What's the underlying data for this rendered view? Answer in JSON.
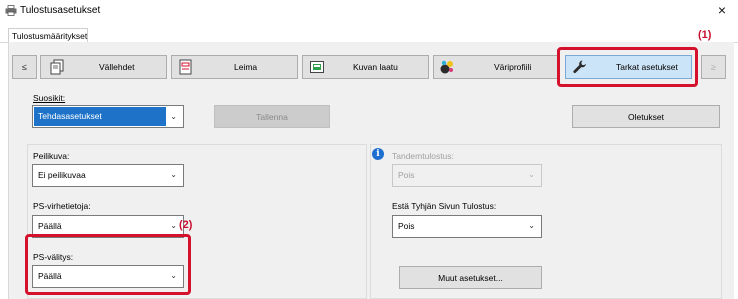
{
  "window": {
    "title": "Tulostusasetukset",
    "close_glyph": "×"
  },
  "tabs": [
    {
      "label": "Tulostusmääritykset"
    }
  ],
  "toolbar": {
    "prev_glyph": "≤",
    "next_glyph": "≥",
    "buttons": [
      {
        "label": "Vällehdet",
        "icon": "pages-icon"
      },
      {
        "label": "Leima",
        "icon": "stamp-icon"
      },
      {
        "label": "Kuvan laatu",
        "icon": "image-quality-icon"
      },
      {
        "label": "Väriprofiili",
        "icon": "color-profile-icon"
      },
      {
        "label": "Tarkat asetukset",
        "icon": "wrench-icon",
        "selected": true
      }
    ]
  },
  "favorites": {
    "label": "Suosikit:",
    "value": "Tehdasasetukset",
    "save_label": "Tallenna",
    "defaults_label": "Oletukset"
  },
  "left": {
    "mirror_label": "Peilikuva:",
    "mirror_value": "Ei peilikuvaa",
    "ps_errors_label": "PS-virhetietoja:",
    "ps_errors_value": "Päällä",
    "ps_passthrough_label": "PS-välitys:",
    "ps_passthrough_value": "Päällä"
  },
  "right": {
    "tandem_label": "Tandemtulostus:",
    "tandem_value": "Pois",
    "blank_page_label": "Estä Tyhjän Sivun Tulostus:",
    "blank_page_value": "Pois",
    "other_settings_label": "Muut asetukset..."
  },
  "callouts": {
    "one": "(1)",
    "two": "(2)"
  },
  "colors": {
    "highlight": "#d4122e",
    "selected_value": "#1e73c9",
    "selected_button": "#cce4f7"
  }
}
